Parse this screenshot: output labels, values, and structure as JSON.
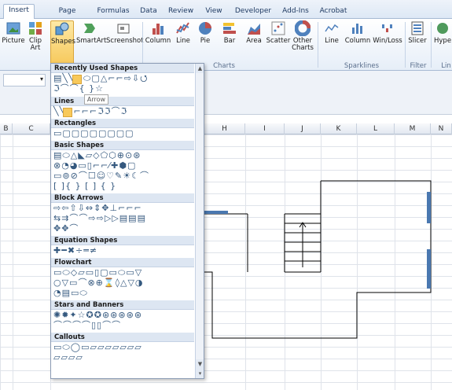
{
  "tabs": [
    "Insert",
    "Page Layout",
    "Formulas",
    "Data",
    "Review",
    "View",
    "Developer",
    "Add-Ins",
    "Acrobat"
  ],
  "ribbon": {
    "buttons": [
      "Picture",
      "Clip Art",
      "Shapes",
      "SmartArt",
      "Screenshot",
      "Column",
      "Line",
      "Pie",
      "Bar",
      "Area",
      "Scatter",
      "Other Charts",
      "Line",
      "Column",
      "Win/Loss",
      "Slicer",
      "Hyperlink"
    ],
    "groups": [
      "Charts",
      "Sparklines",
      "Filter",
      "Lin"
    ]
  },
  "columns": [
    "B",
    "C",
    "H",
    "I",
    "J",
    "K",
    "L",
    "M",
    "N"
  ],
  "gallery": {
    "sections": [
      "Recently Used Shapes",
      "Lines",
      "Rectangles",
      "Basic Shapes",
      "Block Arrows",
      "Equation Shapes",
      "Flowchart",
      "Stars and Banners",
      "Callouts"
    ],
    "tooltip": "Arrow"
  },
  "colors": {
    "accent": "#4a78b0",
    "selected": "#f8c95a",
    "ribbon_bg": "#e6eef8"
  }
}
